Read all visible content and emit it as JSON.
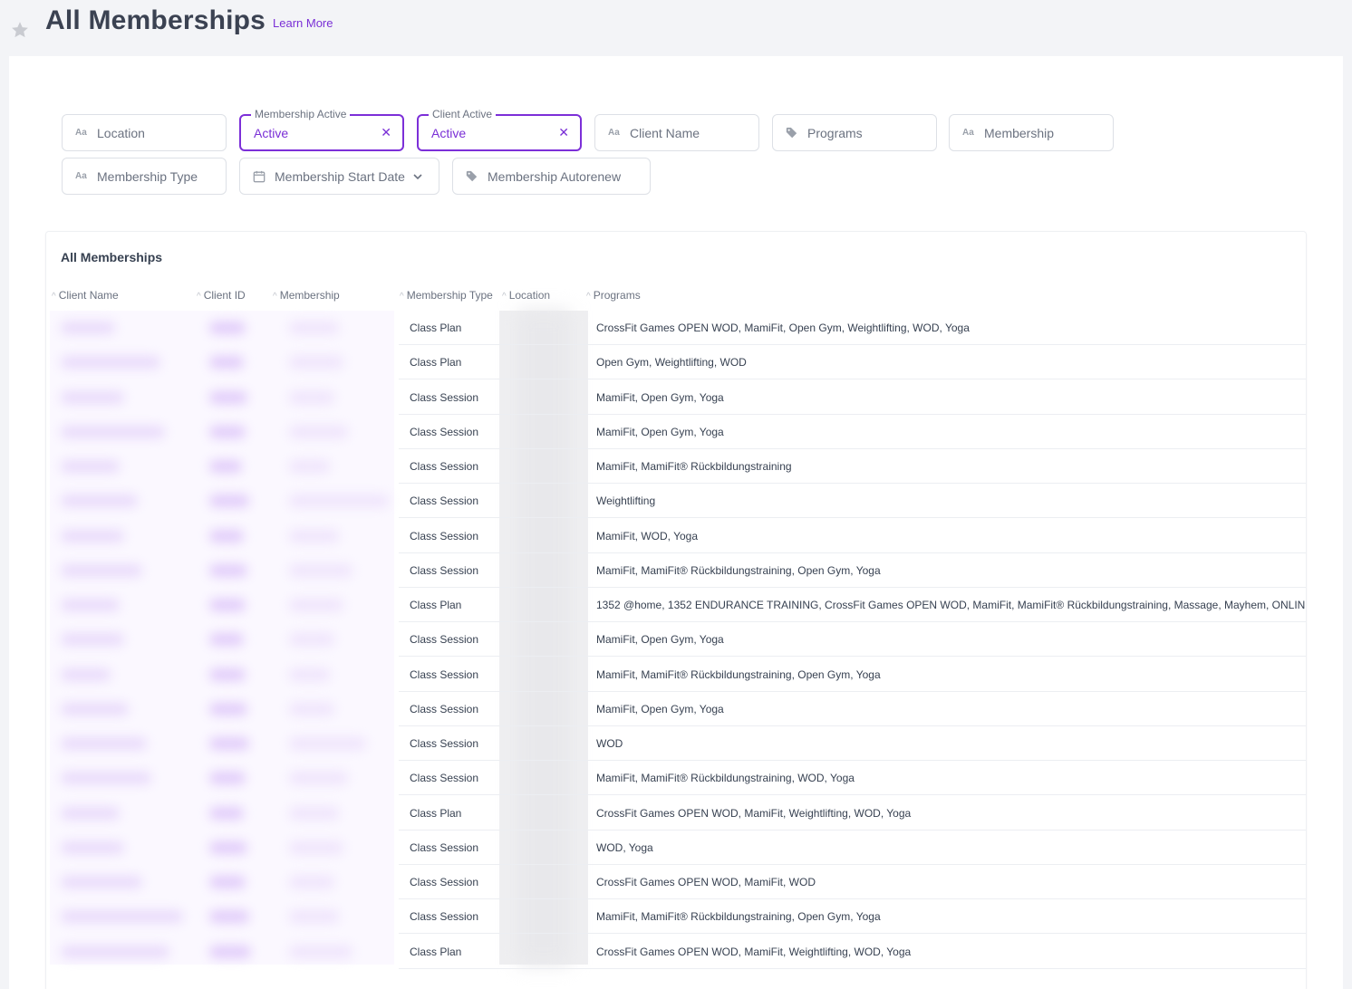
{
  "header": {
    "title": "All Memberships",
    "learn_more": "Learn More"
  },
  "filters": {
    "location": "Location",
    "membership_active": {
      "legend": "Membership Active",
      "value": "Active"
    },
    "client_active": {
      "legend": "Client Active",
      "value": "Active"
    },
    "client_name": "Client Name",
    "programs": "Programs",
    "membership": "Membership",
    "membership_type": "Membership Type",
    "membership_start_date": "Membership Start Date",
    "membership_autorenew": "Membership Autorenew",
    "text_icon": "Aa"
  },
  "table": {
    "title": "All Memberships",
    "columns": {
      "client_name": "Client Name",
      "client_id": "Client ID",
      "membership": "Membership",
      "membership_type": "Membership Type",
      "location": "Location",
      "programs": "Programs"
    },
    "rows": [
      {
        "membership_type": "Class Plan",
        "programs": "CrossFit Games OPEN WOD, MamiFit, Open Gym, Weightlifting, WOD, Yoga"
      },
      {
        "membership_type": "Class Plan",
        "programs": "Open Gym, Weightlifting, WOD"
      },
      {
        "membership_type": "Class Session",
        "programs": "MamiFit, Open Gym, Yoga"
      },
      {
        "membership_type": "Class Session",
        "programs": "MamiFit, Open Gym, Yoga"
      },
      {
        "membership_type": "Class Session",
        "programs": "MamiFit, MamiFit® Rückbildungstraining"
      },
      {
        "membership_type": "Class Session",
        "programs": "Weightlifting"
      },
      {
        "membership_type": "Class Session",
        "programs": "MamiFit, WOD, Yoga"
      },
      {
        "membership_type": "Class Session",
        "programs": "MamiFit, MamiFit® Rückbildungstraining, Open Gym, Yoga"
      },
      {
        "membership_type": "Class Plan",
        "programs": "1352 @home, 1352 ENDURANCE TRAINING, CrossFit Games OPEN WOD, MamiFit, MamiFit® Rückbildungstraining, Massage, Mayhem, ONLINE WOD"
      },
      {
        "membership_type": "Class Session",
        "programs": "MamiFit, Open Gym, Yoga"
      },
      {
        "membership_type": "Class Session",
        "programs": "MamiFit, MamiFit® Rückbildungstraining, Open Gym, Yoga"
      },
      {
        "membership_type": "Class Session",
        "programs": "MamiFit, Open Gym, Yoga"
      },
      {
        "membership_type": "Class Session",
        "programs": "WOD"
      },
      {
        "membership_type": "Class Session",
        "programs": "MamiFit, MamiFit® Rückbildungstraining, WOD, Yoga"
      },
      {
        "membership_type": "Class Plan",
        "programs": "CrossFit Games OPEN WOD, MamiFit, Weightlifting, WOD, Yoga"
      },
      {
        "membership_type": "Class Session",
        "programs": "WOD, Yoga"
      },
      {
        "membership_type": "Class Session",
        "programs": "CrossFit Games OPEN WOD, MamiFit, WOD"
      },
      {
        "membership_type": "Class Session",
        "programs": "MamiFit, MamiFit® Rückbildungstraining, Open Gym, Yoga"
      },
      {
        "membership_type": "Class Plan",
        "programs": "CrossFit Games OPEN WOD, MamiFit, Weightlifting, WOD, Yoga"
      }
    ]
  },
  "colors": {
    "accent": "#7a2fd6",
    "background": "#f3f4f7",
    "title": "#3b4252"
  },
  "icons": [
    "star-icon",
    "text-type-icon",
    "tag-icon",
    "calendar-icon",
    "chevron-down-icon",
    "close-icon",
    "sort-icon"
  ]
}
